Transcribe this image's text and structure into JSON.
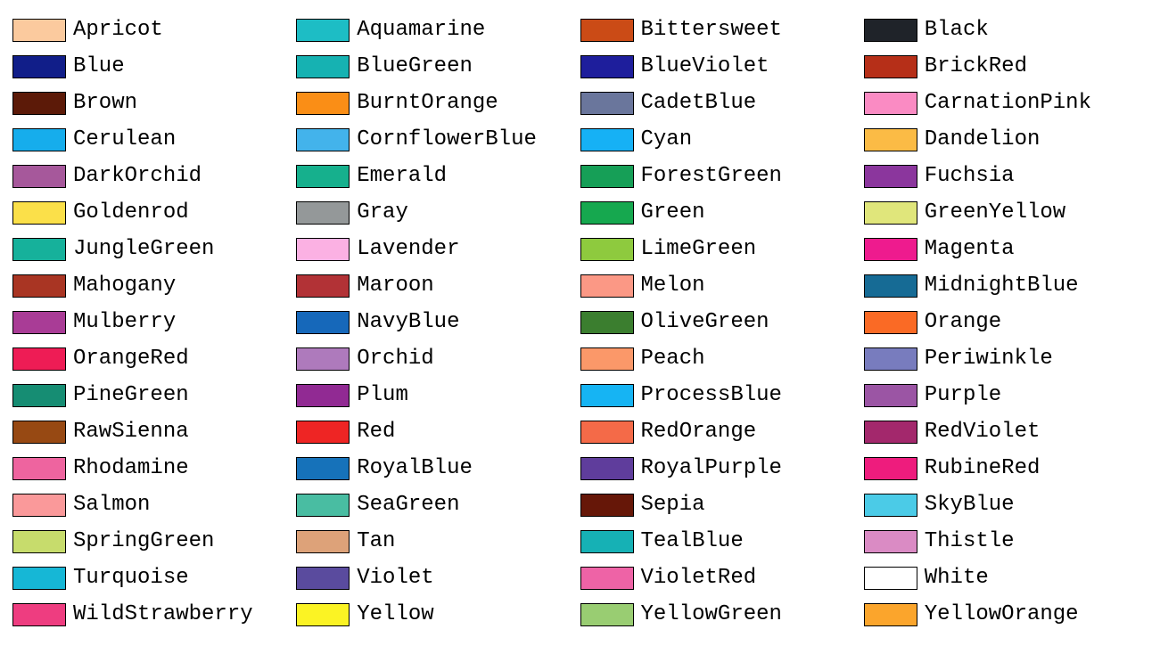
{
  "colors": [
    {
      "name": "Apricot",
      "hex": "#FBCA9E"
    },
    {
      "name": "Aquamarine",
      "hex": "#1DBDC5"
    },
    {
      "name": "Bittersweet",
      "hex": "#CB4B16"
    },
    {
      "name": "Black",
      "hex": "#1F2329"
    },
    {
      "name": "Blue",
      "hex": "#111E89"
    },
    {
      "name": "BlueGreen",
      "hex": "#16B2B2"
    },
    {
      "name": "BlueViolet",
      "hex": "#1E1E9C"
    },
    {
      "name": "BrickRed",
      "hex": "#B62F18"
    },
    {
      "name": "Brown",
      "hex": "#5C1A08"
    },
    {
      "name": "BurntOrange",
      "hex": "#FA8E16"
    },
    {
      "name": "CadetBlue",
      "hex": "#6A769C"
    },
    {
      "name": "CarnationPink",
      "hex": "#FA8BC3"
    },
    {
      "name": "Cerulean",
      "hex": "#16ADEC"
    },
    {
      "name": "CornflowerBlue",
      "hex": "#43B3EB"
    },
    {
      "name": "Cyan",
      "hex": "#16B1F5"
    },
    {
      "name": "Dandelion",
      "hex": "#FBBB45"
    },
    {
      "name": "DarkOrchid",
      "hex": "#A6589B"
    },
    {
      "name": "Emerald",
      "hex": "#16B08D"
    },
    {
      "name": "ForestGreen",
      "hex": "#169F57"
    },
    {
      "name": "Fuchsia",
      "hex": "#8B369D"
    },
    {
      "name": "Goldenrod",
      "hex": "#FBE049"
    },
    {
      "name": "Gray",
      "hex": "#949899"
    },
    {
      "name": "Green",
      "hex": "#16A84F"
    },
    {
      "name": "GreenYellow",
      "hex": "#E0E67B"
    },
    {
      "name": "JungleGreen",
      "hex": "#16B19B"
    },
    {
      "name": "Lavender",
      "hex": "#FBB1E3"
    },
    {
      "name": "LimeGreen",
      "hex": "#8ECA3E"
    },
    {
      "name": "Magenta",
      "hex": "#EE1B8E"
    },
    {
      "name": "Mahogany",
      "hex": "#A93523"
    },
    {
      "name": "Maroon",
      "hex": "#B23236"
    },
    {
      "name": "Melon",
      "hex": "#FB9885"
    },
    {
      "name": "MidnightBlue",
      "hex": "#166B95"
    },
    {
      "name": "Mulberry",
      "hex": "#A93C96"
    },
    {
      "name": "NavyBlue",
      "hex": "#1668BA"
    },
    {
      "name": "OliveGreen",
      "hex": "#3B7E2F"
    },
    {
      "name": "Orange",
      "hex": "#FA6A25"
    },
    {
      "name": "OrangeRed",
      "hex": "#EE1C55"
    },
    {
      "name": "Orchid",
      "hex": "#AE7ABC"
    },
    {
      "name": "Peach",
      "hex": "#FB9869"
    },
    {
      "name": "Periwinkle",
      "hex": "#787CBE"
    },
    {
      "name": "PineGreen",
      "hex": "#168D73"
    },
    {
      "name": "Plum",
      "hex": "#912A93"
    },
    {
      "name": "ProcessBlue",
      "hex": "#16B4F3"
    },
    {
      "name": "Purple",
      "hex": "#9B55A4"
    },
    {
      "name": "RawSienna",
      "hex": "#974913"
    },
    {
      "name": "Red",
      "hex": "#EE2524"
    },
    {
      "name": "RedOrange",
      "hex": "#F46A48"
    },
    {
      "name": "RedViolet",
      "hex": "#A3286C"
    },
    {
      "name": "Rhodamine",
      "hex": "#EE649F"
    },
    {
      "name": "RoyalBlue",
      "hex": "#1672BA"
    },
    {
      "name": "RoyalPurple",
      "hex": "#5F3D9C"
    },
    {
      "name": "RubineRed",
      "hex": "#EE1C7D"
    },
    {
      "name": "Salmon",
      "hex": "#FA999A"
    },
    {
      "name": "SeaGreen",
      "hex": "#49BDA2"
    },
    {
      "name": "Sepia",
      "hex": "#661708"
    },
    {
      "name": "SkyBlue",
      "hex": "#4BCBE7"
    },
    {
      "name": "SpringGreen",
      "hex": "#C7DC6C"
    },
    {
      "name": "Tan",
      "hex": "#DDA279"
    },
    {
      "name": "TealBlue",
      "hex": "#16B1B5"
    },
    {
      "name": "Thistle",
      "hex": "#DA8BC4"
    },
    {
      "name": "Turquoise",
      "hex": "#16B7D6"
    },
    {
      "name": "Violet",
      "hex": "#5A4B9E"
    },
    {
      "name": "VioletRed",
      "hex": "#EE63A6"
    },
    {
      "name": "White",
      "hex": "#FFFFFF"
    },
    {
      "name": "WildStrawberry",
      "hex": "#EE3D80"
    },
    {
      "name": "Yellow",
      "hex": "#FBF324"
    },
    {
      "name": "YellowGreen",
      "hex": "#99CD72"
    },
    {
      "name": "YellowOrange",
      "hex": "#FBA52C"
    }
  ]
}
